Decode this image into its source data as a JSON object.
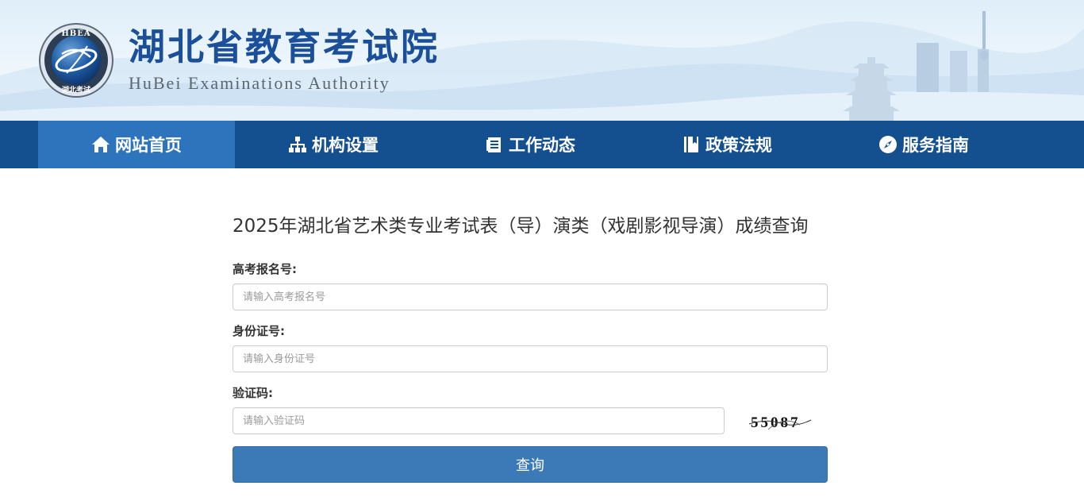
{
  "header": {
    "emblem_text": "HBEA",
    "emblem_bottom_text": "湖北考试",
    "title": "湖北省教育考试院",
    "subtitle": "HuBei Examinations Authority"
  },
  "nav": {
    "items": [
      {
        "label": "网站首页",
        "icon": "home-icon",
        "active": true
      },
      {
        "label": "机构设置",
        "icon": "org-chart-icon",
        "active": false
      },
      {
        "label": "工作动态",
        "icon": "document-icon",
        "active": false
      },
      {
        "label": "政策法规",
        "icon": "book-icon",
        "active": false
      },
      {
        "label": "服务指南",
        "icon": "compass-icon",
        "active": false
      }
    ]
  },
  "form": {
    "title": "2025年湖北省艺术类专业考试表（导）演类（戏剧影视导演）成绩查询",
    "exam_no_label": "高考报名号:",
    "exam_no_placeholder": "请输入高考报名号",
    "exam_no_value": "",
    "id_label": "身份证号:",
    "id_placeholder": "请输入身份证号",
    "id_value": "",
    "captcha_label": "验证码:",
    "captcha_placeholder": "请输入验证码",
    "captcha_value": "",
    "captcha_image_text": "55087",
    "submit_label": "查询"
  },
  "colors": {
    "nav_bg": "#144f8f",
    "nav_active": "#2d74bc",
    "title_blue": "#1b4f9a",
    "button_bg": "#3c7ab7"
  }
}
